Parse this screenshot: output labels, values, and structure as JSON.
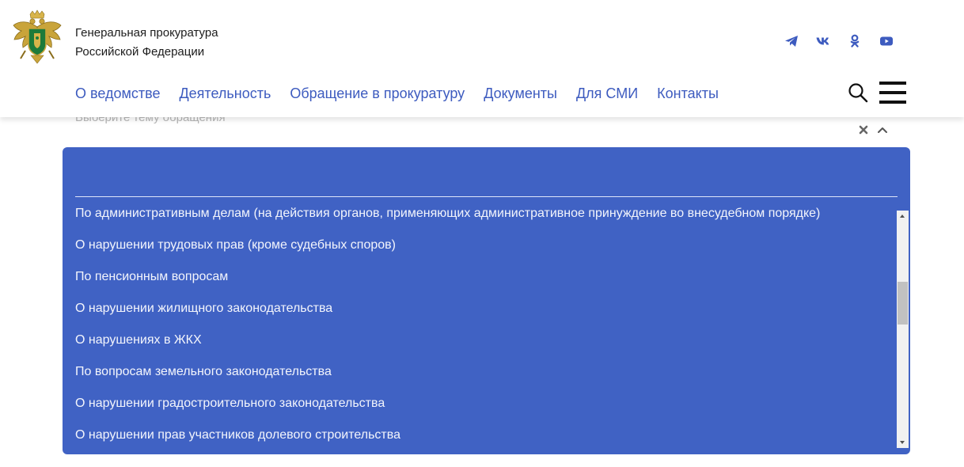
{
  "header": {
    "org_name_line1": "Генеральная прокуратура",
    "org_name_line2": "Российской Федерации",
    "socials": [
      {
        "icon": "telegram-icon",
        "color": "#3d5bbf"
      },
      {
        "icon": "vk-icon",
        "color": "#3d5bbf"
      },
      {
        "icon": "odnoklassniki-icon",
        "color": "#3d5bbf"
      },
      {
        "icon": "youtube-icon",
        "color": "#3d5bbf"
      }
    ],
    "nav": [
      "О ведомстве",
      "Деятельность",
      "Обращение в прокуратуру",
      "Документы",
      "Для СМИ",
      "Контакты"
    ],
    "icons": {
      "search": "search-icon",
      "menu": "hamburger-menu-icon"
    }
  },
  "select": {
    "placeholder": "Выберите тему обращения",
    "clear_icon": "close-icon",
    "toggle_icon": "chevron-up-icon"
  },
  "dropdown": {
    "search_value": "",
    "options": [
      "По административным делам (на действия органов, применяющих административное принуждение во внесудебном порядке)",
      "О нарушении трудовых прав (кроме судебных споров)",
      "По пенсионным вопросам",
      "О нарушении жилищного законодательства",
      "О нарушениях в ЖКХ",
      "По вопросам земельного законодательства",
      "О нарушении градостроительного законодательства",
      "О нарушении прав участников долевого строительства"
    ]
  },
  "colors": {
    "accent": "#3d5bbf",
    "dropdown_bg": "#4062c4",
    "option_text": "#f3f5fc",
    "placeholder": "#b7b7b7"
  }
}
